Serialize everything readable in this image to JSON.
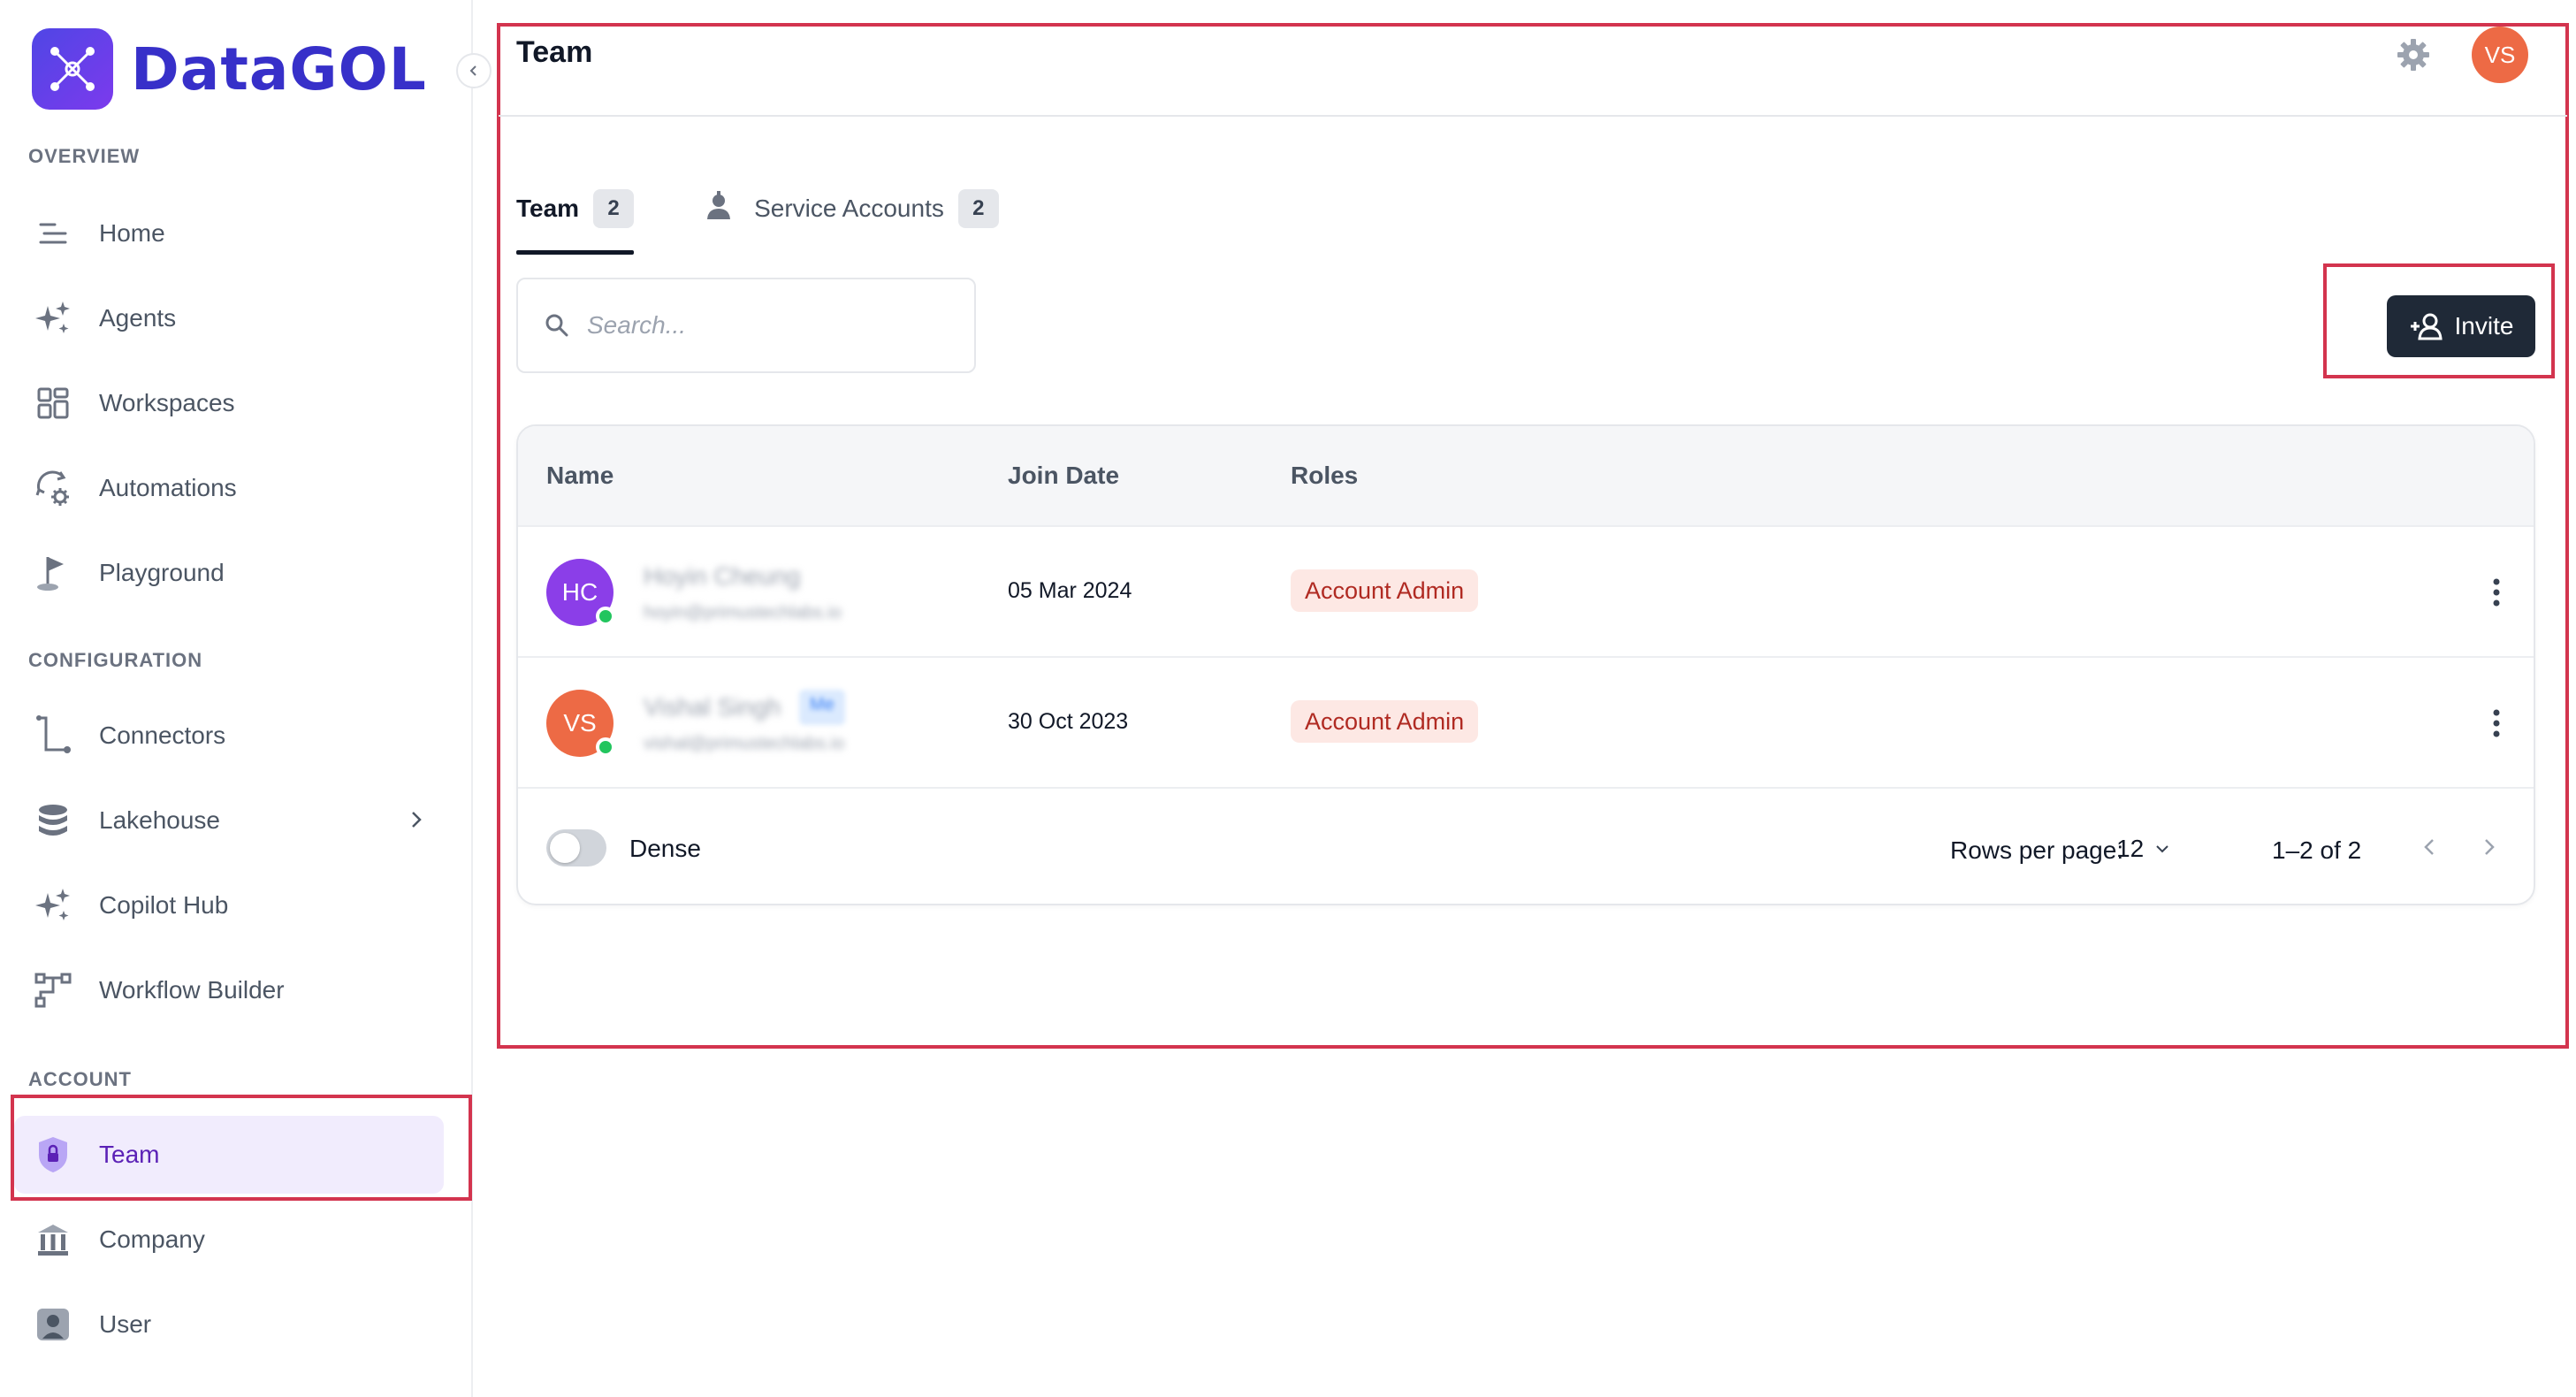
{
  "app": {
    "name": "DataGOL"
  },
  "sidebar": {
    "sections": {
      "overview": "OVERVIEW",
      "configuration": "CONFIGURATION",
      "account": "ACCOUNT"
    },
    "items": [
      {
        "label": "Home",
        "icon": "home-lines-icon"
      },
      {
        "label": "Agents",
        "icon": "sparkle-icon"
      },
      {
        "label": "Workspaces",
        "icon": "grid-icon"
      },
      {
        "label": "Automations",
        "icon": "automation-gear-icon"
      },
      {
        "label": "Playground",
        "icon": "flag-icon"
      },
      {
        "label": "Connectors",
        "icon": "connector-path-icon"
      },
      {
        "label": "Lakehouse",
        "icon": "database-icon"
      },
      {
        "label": "Copilot Hub",
        "icon": "sparkle-icon"
      },
      {
        "label": "Workflow Builder",
        "icon": "workflow-icon"
      },
      {
        "label": "Team",
        "icon": "shield-lock-icon",
        "active": true
      },
      {
        "label": "Company",
        "icon": "bank-icon"
      },
      {
        "label": "User",
        "icon": "user-icon"
      }
    ]
  },
  "header": {
    "title": "Team",
    "user_initials": "VS"
  },
  "tabs": [
    {
      "label": "Team",
      "count": "2",
      "active": true
    },
    {
      "label": "Service Accounts",
      "count": "2",
      "active": false
    }
  ],
  "search": {
    "placeholder": "Search..."
  },
  "invite_button": {
    "label": "Invite"
  },
  "table": {
    "columns": [
      "Name",
      "Join Date",
      "Roles"
    ],
    "rows": [
      {
        "initials": "HC",
        "avatar_color": "#8b3ee8",
        "name": "Hoyin Cheung",
        "email": "hoyin@primustechlabs.io",
        "join_date": "05 Mar 2024",
        "role": "Account Admin"
      },
      {
        "initials": "VS",
        "avatar_color": "#ed6a45",
        "name": "Vishal Singh",
        "email": "vishal@primustechlabs.io",
        "tag": "Me",
        "join_date": "30 Oct 2023",
        "role": "Account Admin"
      }
    ],
    "footer": {
      "dense_label": "Dense",
      "rows_per_page_label": "Rows per page:",
      "rows_per_page_value": "12",
      "page_range": "1–2 of 2"
    }
  },
  "colors": {
    "brand": "#3730c9",
    "active_nav_bg": "#f1ecfd",
    "active_nav_text": "#5b21b6",
    "highlight_box": "#d3344e",
    "role_chip_bg": "#fde8e4",
    "role_chip_text": "#b02a22",
    "button_dark": "#1f2937"
  }
}
